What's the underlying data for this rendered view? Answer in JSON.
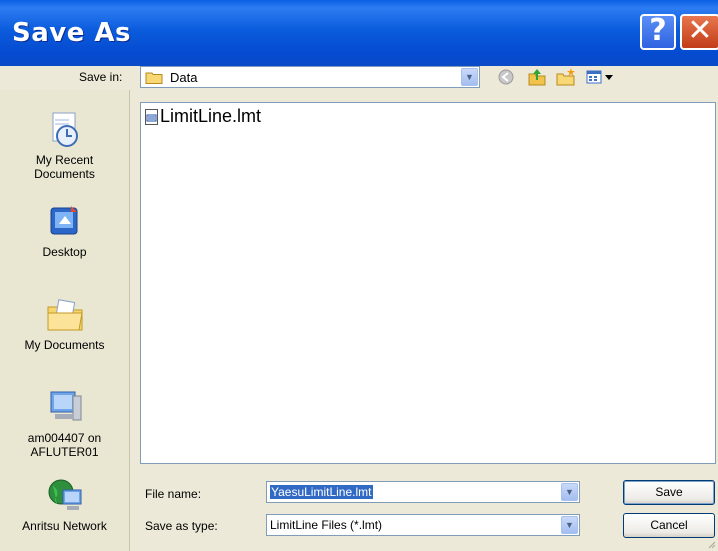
{
  "window": {
    "title": "Save As"
  },
  "titlebar": {
    "help": "?",
    "close": "✕"
  },
  "savein": {
    "label": "Save in:",
    "value": "Data"
  },
  "places": [
    {
      "label1": "My Recent",
      "label2": "Documents"
    },
    {
      "label1": "Desktop",
      "label2": ""
    },
    {
      "label1": "My Documents",
      "label2": ""
    },
    {
      "label1": "am004407 on",
      "label2": "AFLUTER01"
    },
    {
      "label1": "Anritsu Network",
      "label2": ""
    }
  ],
  "files": [
    {
      "name": "LimitLine.lmt"
    }
  ],
  "filename": {
    "label": "File name:",
    "value": "YaesuLimitLine.lmt"
  },
  "filetype": {
    "label": "Save as type:",
    "value": "LimitLine Files (*.lmt)"
  },
  "buttons": {
    "save": "Save",
    "cancel": "Cancel"
  },
  "colors": {
    "titlebar": "#0A5FE4",
    "selection": "#316AC5",
    "dialog_bg": "#ECE9D8"
  }
}
